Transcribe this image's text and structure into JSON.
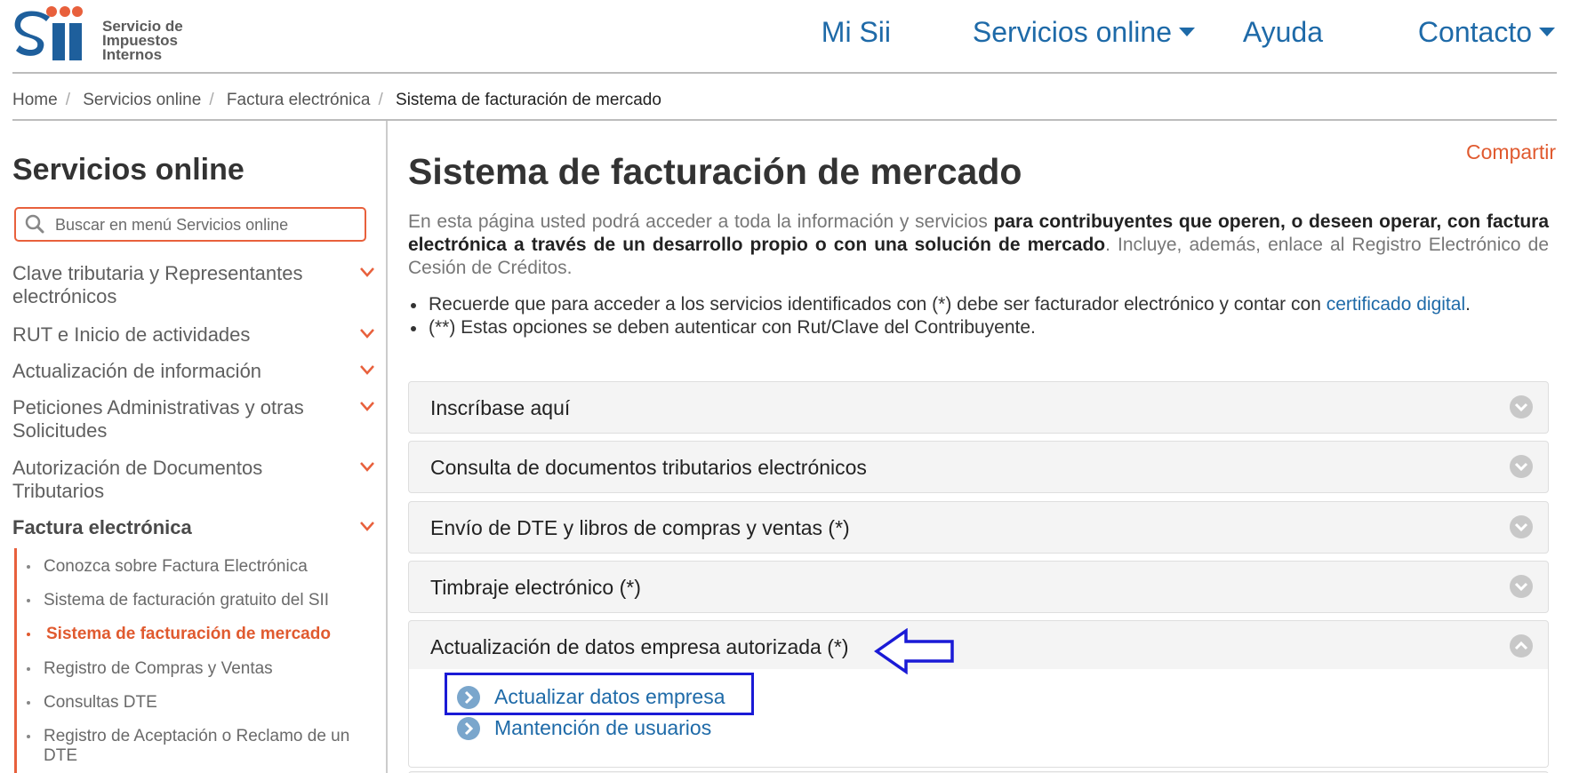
{
  "header": {
    "logo_text": "Servicio de Impuestos Internos",
    "nav": [
      {
        "label": "Mi Sii",
        "dropdown": false
      },
      {
        "label": "Servicios online",
        "dropdown": true
      },
      {
        "label": "Ayuda",
        "dropdown": false
      },
      {
        "label": "Contacto",
        "dropdown": true
      }
    ]
  },
  "breadcrumb": [
    "Home",
    "Servicios online",
    "Factura electrónica",
    "Sistema de facturación de mercado"
  ],
  "sidebar": {
    "title": "Servicios online",
    "search_placeholder": "Buscar en menú Servicios online",
    "items": [
      "Clave tributaria y Representantes electrónicos",
      "RUT e Inicio de actividades",
      "Actualización de información",
      "Peticiones Administrativas y otras Solicitudes",
      "Autorización de Documentos Tributarios",
      "Factura electrónica"
    ],
    "subitems": [
      "Conozca sobre Factura Electrónica",
      "Sistema de facturación gratuito del SII",
      "Sistema de facturación de mercado",
      "Registro de Compras y Ventas",
      "Consultas DTE",
      "Registro de Aceptación o Reclamo de un DTE"
    ]
  },
  "main": {
    "share": "Compartir",
    "title": "Sistema de facturación de mercado",
    "intro_1": "En esta página usted podrá acceder a toda la información y servicios ",
    "intro_bold": "para contribuyentes que operen, o deseen operar, con factura electrónica a través de un desarrollo propio o con una solución de mercado",
    "intro_2": ". Incluye, además, enlace al Registro Electrónico de Cesión de Créditos.",
    "note_1": "Recuerde que para acceder a los servicios identificados con (*) debe ser facturador electrónico y contar con ",
    "note_1_link": "certificado digital",
    "note_1_end": ".",
    "note_2": "(**) Estas opciones se deben autenticar con Rut/Clave del Contribuyente.",
    "accordions": [
      "Inscríbase aquí",
      "Consulta de documentos tributarios electrónicos",
      "Envío de DTE y libros de compras y ventas (*)",
      "Timbraje electrónico (*)",
      "Actualización de datos empresa autorizada (*)"
    ],
    "open_links": [
      "Actualizar datos empresa",
      "Mantención de usuarios"
    ]
  },
  "colors": {
    "brand_blue": "#1e6aa8",
    "accent_orange": "#e8603c",
    "annotation_blue": "#1a1ad6"
  }
}
